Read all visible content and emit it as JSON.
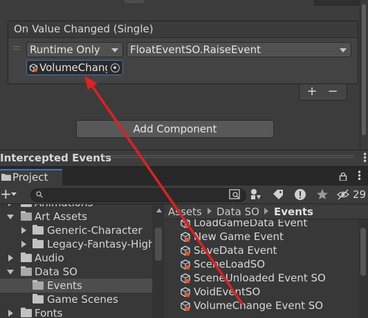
{
  "colors": {
    "accent_blue": "#3a79bb",
    "annotation_red": "#e02020",
    "panel_bg": "#383838"
  },
  "event": {
    "header": "On Value Changed (Single)",
    "runtime_dropdown": "Runtime Only",
    "method_dropdown": "FloatEventSO.RaiseEvent",
    "object_field": "VolumeChang"
  },
  "inspector": {
    "add_label": "+",
    "remove_label": "−",
    "add_component": "Add Component"
  },
  "intercepted": {
    "title": "Intercepted Events"
  },
  "project": {
    "tab": "Project",
    "create_label": "+",
    "hidden_count": "29",
    "search_placeholder": "",
    "toolbar_icons": [
      "search-by-type-icon",
      "search-by-label-icon",
      "warning-icon",
      "favorite-star-icon",
      "hidden-packages-icon"
    ]
  },
  "tree": [
    {
      "label": "Animations",
      "indent": 0,
      "expanded": false,
      "has_arrow": true
    },
    {
      "label": "Art Assets",
      "indent": 0,
      "expanded": true,
      "has_arrow": true
    },
    {
      "label": "Generic-Character",
      "indent": 1,
      "expanded": false,
      "has_arrow": true
    },
    {
      "label": "Legacy-Fantasy-High",
      "indent": 1,
      "expanded": false,
      "has_arrow": true
    },
    {
      "label": "Audio",
      "indent": 0,
      "expanded": false,
      "has_arrow": true
    },
    {
      "label": "Data SO",
      "indent": 0,
      "expanded": true,
      "has_arrow": true
    },
    {
      "label": "Events",
      "indent": 1,
      "expanded": false,
      "has_arrow": false,
      "selected": true
    },
    {
      "label": "Game Scenes",
      "indent": 1,
      "expanded": false,
      "has_arrow": false
    },
    {
      "label": "Fonts",
      "indent": 0,
      "expanded": false,
      "has_arrow": true
    }
  ],
  "breadcrumb": [
    "Assets",
    "Data SO",
    "Events"
  ],
  "files": [
    "LoadGameData Event",
    "New Game Event",
    "SaveData Event",
    "SceneLoadSO",
    "SceneUnloaded Event SO",
    "VoidEventSO",
    "VolumeChange Event SO"
  ]
}
